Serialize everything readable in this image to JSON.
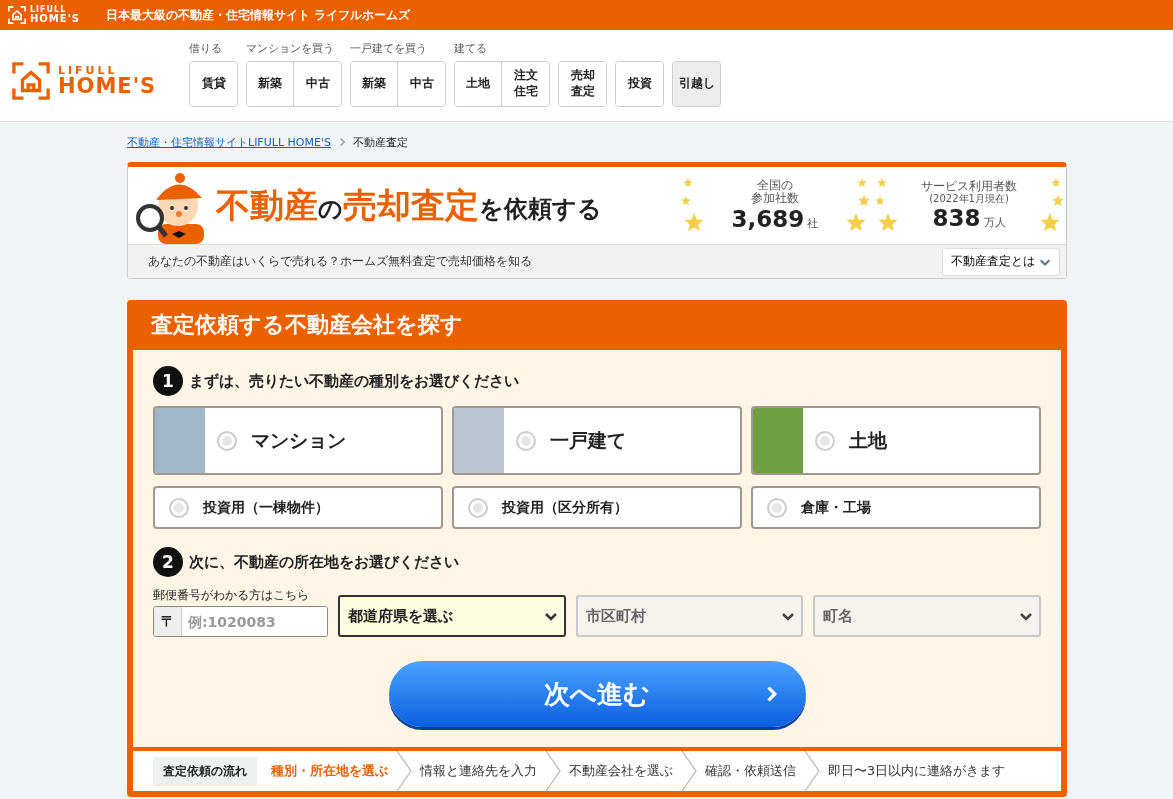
{
  "topbar": {
    "logo_lines": [
      "LIFULL",
      "HOME'S"
    ],
    "tagline": "日本最大級の不動産・住宅情報サイト ライフルホームズ"
  },
  "header": {
    "logo_lines": [
      "LIFULL",
      "HOME'S"
    ],
    "nav_groups": [
      {
        "label": "借りる",
        "items": [
          {
            "label": "賃貸",
            "kind": "plain"
          }
        ]
      },
      {
        "label": "マンションを買う",
        "items": [
          {
            "label": "新築",
            "kind": "plain"
          },
          {
            "label": "中古",
            "kind": "plain"
          }
        ]
      },
      {
        "label": "一戸建てを買う",
        "items": [
          {
            "label": "新築",
            "kind": "plain"
          },
          {
            "label": "中古",
            "kind": "plain"
          }
        ]
      },
      {
        "label": "建てる",
        "items": [
          {
            "label": "土地",
            "kind": "plain"
          },
          {
            "label": "注文住宅",
            "kind": "plain"
          }
        ]
      },
      {
        "items": [
          {
            "label": "売却査定",
            "kind": "plain"
          }
        ]
      },
      {
        "items": [
          {
            "label": "投資",
            "kind": "plain"
          }
        ]
      },
      {
        "items": [
          {
            "label": "引越し",
            "kind": "shaded"
          }
        ]
      }
    ]
  },
  "breadcrumb": [
    {
      "label": "不動産・住宅情報サイトLIFULL HOME'S",
      "kind": "link"
    },
    {
      "label": "不動産査定",
      "kind": "current"
    }
  ],
  "hero": {
    "title_parts": [
      {
        "text": "不動産",
        "kind": "accent"
      },
      {
        "text": "の",
        "kind": "plain"
      },
      {
        "text": "売却査定",
        "kind": "accent"
      },
      {
        "text": "を依頼する",
        "kind": "plain"
      }
    ],
    "stats": [
      {
        "label_lines": [
          "全国の",
          "参加社数"
        ],
        "value": "3,689",
        "unit": "社"
      },
      {
        "label_lines": [
          "サービス利用者数",
          "(2022年1月現在)"
        ],
        "value": "838",
        "unit": "万人"
      }
    ],
    "subtitle": "あなたの不動産はいくらで売れる？ホームズ無料査定で売却価格を知る",
    "about_button": "不動産査定とは"
  },
  "panel": {
    "title": "査定依頼する不動産会社を探す",
    "step1": {
      "number": "1",
      "title": "まずは、売りたい不動産の種別をお選びください",
      "options": [
        {
          "label": "マンション",
          "kind": "photo",
          "selected": false
        },
        {
          "label": "一戸建て",
          "kind": "photo",
          "selected": false
        },
        {
          "label": "土地",
          "kind": "photo",
          "selected": false
        },
        {
          "label": "投資用（一棟物件）",
          "kind": "plain",
          "selected": false
        },
        {
          "label": "投資用（区分所有）",
          "kind": "plain",
          "selected": false
        },
        {
          "label": "倉庫・工場",
          "kind": "plain",
          "selected": false
        }
      ]
    },
    "step2": {
      "number": "2",
      "title": "次に、不動産の所在地をお選びください",
      "postal": {
        "label": "郵便番号がわかる方はこちら",
        "prefix": "〒",
        "placeholder": "例:1020083"
      },
      "selects": [
        {
          "value": "都道府県を選ぶ",
          "disabled": false
        },
        {
          "value": "市区町村",
          "disabled": true
        },
        {
          "value": "町名",
          "disabled": true
        }
      ]
    },
    "next_button": "次へ進む",
    "flow": {
      "label": "査定依頼の流れ",
      "steps": [
        {
          "label": "種別・所在地を選ぶ",
          "selected": true
        },
        {
          "label": "情報と連絡先を入力",
          "selected": false
        },
        {
          "label": "不動産会社を選ぶ",
          "selected": false
        },
        {
          "label": "確認・依頼送信",
          "selected": false
        },
        {
          "label": "即日〜3日以内に連絡がきます",
          "selected": false
        }
      ]
    }
  }
}
